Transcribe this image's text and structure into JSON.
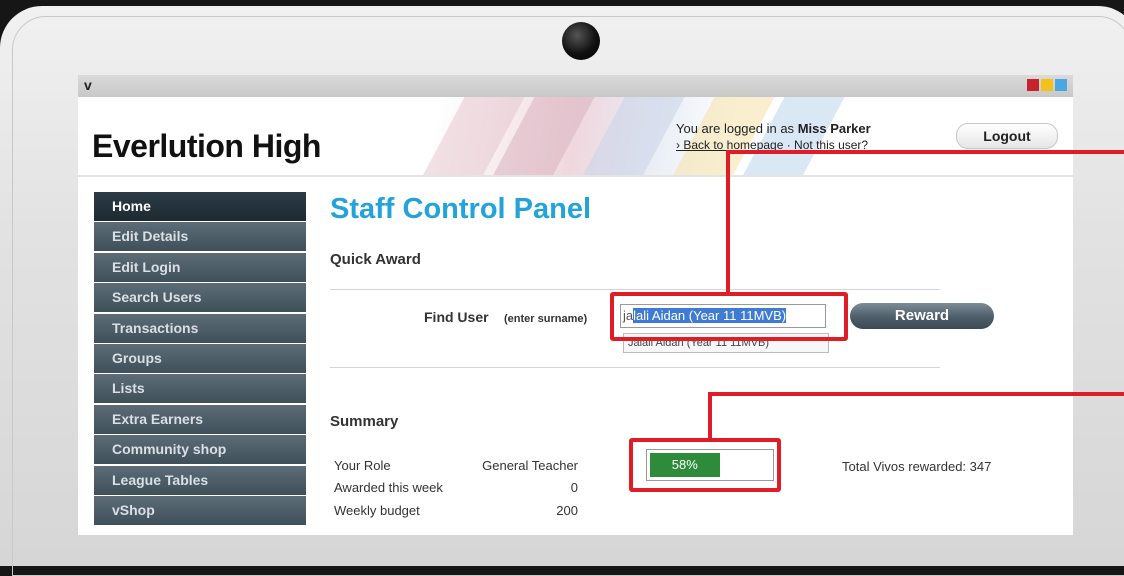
{
  "window": {
    "logo": "v"
  },
  "header": {
    "school_name": "Everlution High",
    "login_prefix": "You are logged in as",
    "login_user": "Miss Parker",
    "links": "› Back to homepage · Not this user?",
    "logout_label": "Logout"
  },
  "sidebar": {
    "items": [
      {
        "label": "Home"
      },
      {
        "label": "Edit Details"
      },
      {
        "label": "Edit Login"
      },
      {
        "label": "Search Users"
      },
      {
        "label": "Transactions"
      },
      {
        "label": "Groups"
      },
      {
        "label": "Lists"
      },
      {
        "label": "Extra Earners"
      },
      {
        "label": "Community shop"
      },
      {
        "label": "League Tables"
      },
      {
        "label": "vShop"
      }
    ]
  },
  "main": {
    "title": "Staff Control Panel",
    "quick_award": {
      "heading": "Quick Award",
      "find_label": "Find User",
      "find_hint": "(enter surname)",
      "search_typed": "ja",
      "search_autocomplete": "lali Aidan (Year 11 11MVB)",
      "suggestion": "Jalali Aidan (Year 11 11MVB)",
      "reward_label": "Reward"
    },
    "summary": {
      "heading": "Summary",
      "role_label": "Your Role",
      "role_value": "General Teacher",
      "awarded_label": "Awarded this week",
      "awarded_value": "0",
      "budget_label": "Weekly budget",
      "budget_value": "200",
      "progress_text": "58%",
      "progress_value": 58,
      "total_text": "Total Vivos rewarded: 347"
    }
  },
  "colors": {
    "accent": "#23a3dc",
    "callout": "#e01d26",
    "progress": "#2e8b3a",
    "nav": "#4a5a64"
  }
}
